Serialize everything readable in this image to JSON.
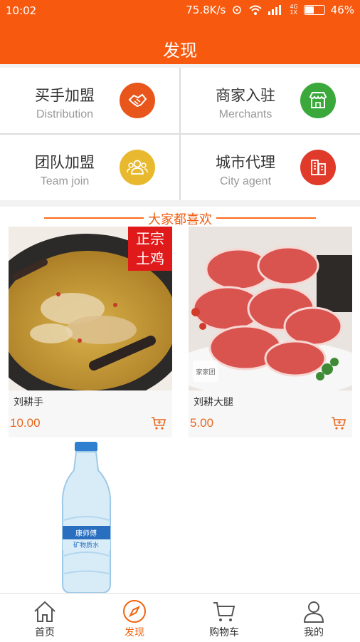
{
  "status_bar": {
    "time": "10:02",
    "net_speed": "75.8K/s",
    "signal_small": "4G",
    "signal_small2": "1X",
    "battery": "46%"
  },
  "header": {
    "title": "发现"
  },
  "entries": [
    {
      "zh": "买手加盟",
      "en": "Distribution",
      "color": "#e8561b",
      "icon": "handshake-icon"
    },
    {
      "zh": "商家入驻",
      "en": "Merchants",
      "color": "#3ba83c",
      "icon": "store-icon"
    },
    {
      "zh": "团队加盟",
      "en": "Team join",
      "color": "#e8b92e",
      "icon": "team-icon"
    },
    {
      "zh": "城市代理",
      "en": "City agent",
      "color": "#df3a2a",
      "icon": "building-icon"
    }
  ],
  "section": {
    "title": "大家都喜欢"
  },
  "products": [
    {
      "name": "刘耕手",
      "price": "10.00",
      "badge": [
        "正宗",
        "土鸡"
      ]
    },
    {
      "name": "刘耕大腿",
      "price": "5.00",
      "watermark": "家家团"
    },
    {
      "bottle_label": "康师傅",
      "bottle_sub": "矿物质水"
    }
  ],
  "tabbar": {
    "items": [
      {
        "label": "首页",
        "icon": "home-icon"
      },
      {
        "label": "发现",
        "icon": "compass-icon",
        "active": true
      },
      {
        "label": "购物车",
        "icon": "cart-icon"
      },
      {
        "label": "我的",
        "icon": "user-icon"
      }
    ]
  },
  "colors": {
    "primary": "#f75a0f",
    "price": "#e8671e"
  }
}
